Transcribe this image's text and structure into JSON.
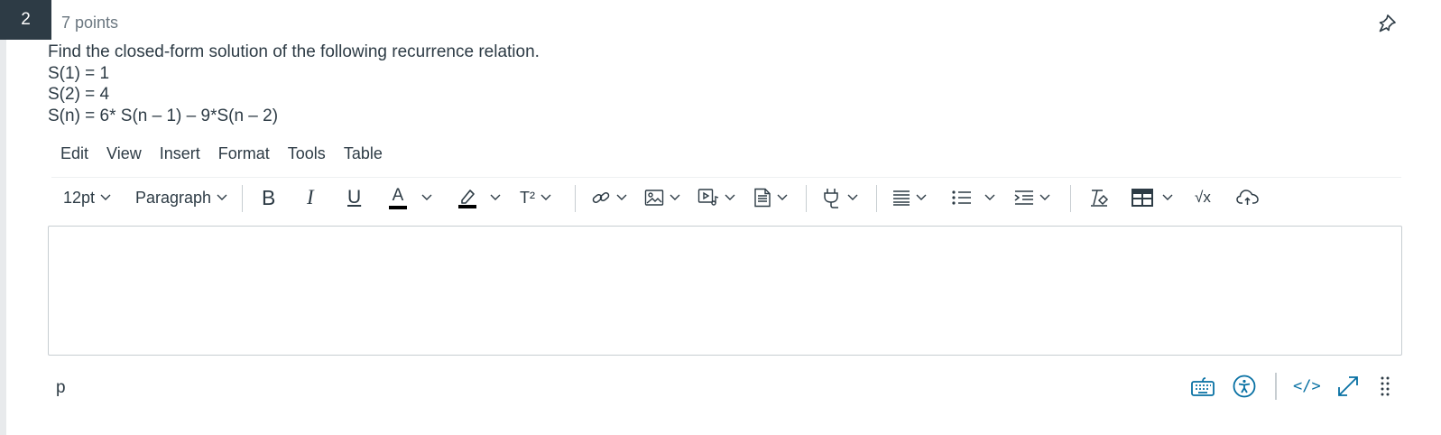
{
  "question": {
    "number": "2",
    "points": "7 points",
    "lines": [
      "Find the closed-form solution of the following recurrence relation.",
      "S(1) = 1",
      "S(2) = 4",
      "S(n) = 6* S(n – 1) – 9*S(n – 2)"
    ]
  },
  "editor": {
    "menu": [
      "Edit",
      "View",
      "Insert",
      "Format",
      "Tools",
      "Table"
    ],
    "toolbar": {
      "font_size": "12pt",
      "block_format": "Paragraph",
      "bold": "B",
      "italic": "I",
      "underline": "U",
      "text_color": "A",
      "superscript": "T²",
      "math": "√x"
    },
    "statusbar": {
      "path": "p",
      "html_editor": "</>"
    },
    "colors": {
      "accent": "#0770a3",
      "text": "#2d3b45",
      "question_badge": "#2d3b45"
    }
  }
}
